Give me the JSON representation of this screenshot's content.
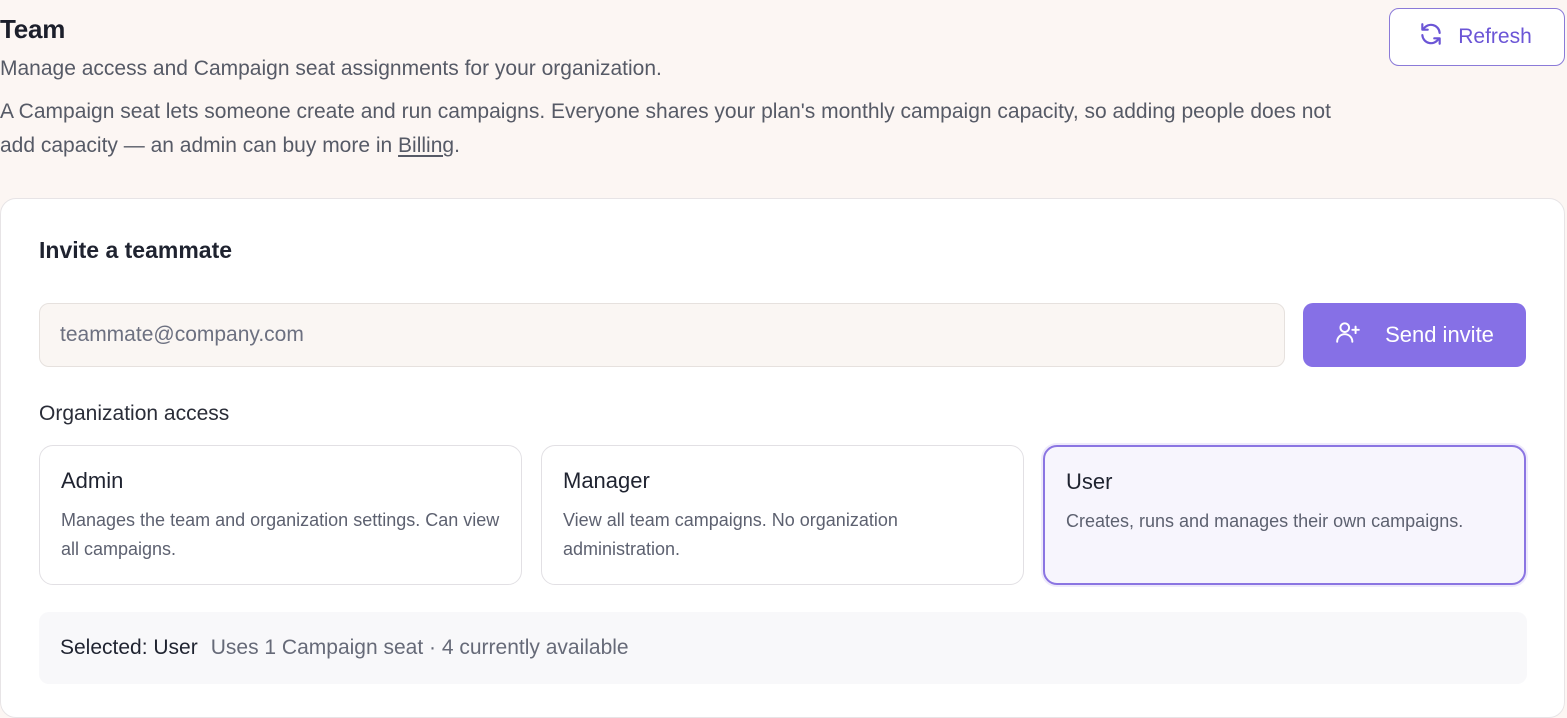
{
  "header": {
    "title": "Team",
    "subtitle": "Manage access and Campaign seat assignments for your organization.",
    "description_before_link": "A Campaign seat lets someone create and run campaigns. Everyone shares your plan's monthly campaign capacity, so adding people does not add capacity — an admin can buy more in ",
    "billing_link": "Billing",
    "description_after_link": ".",
    "refresh_label": "Refresh",
    "refresh_icon": "refresh-icon"
  },
  "invite": {
    "title": "Invite a teammate",
    "email_placeholder": "teammate@company.com",
    "email_value": "",
    "send_label": "Send invite",
    "send_icon": "user-plus-icon"
  },
  "access": {
    "label": "Organization access",
    "roles": [
      {
        "name": "Admin",
        "description": "Manages the team and organization settings. Can view all campaigns.",
        "selected": false
      },
      {
        "name": "Manager",
        "description": "View all team campaigns. No organization administration.",
        "selected": false
      },
      {
        "name": "User",
        "description": "Creates, runs and manages their own campaigns.",
        "selected": true
      }
    ]
  },
  "summary": {
    "selected_text": "Selected: User",
    "seat_text": "Uses 1 Campaign seat · 4 currently available"
  },
  "colors": {
    "accent": "#8670e6",
    "accent_text": "#6b55d6",
    "page_background": "#fcf6f3"
  }
}
